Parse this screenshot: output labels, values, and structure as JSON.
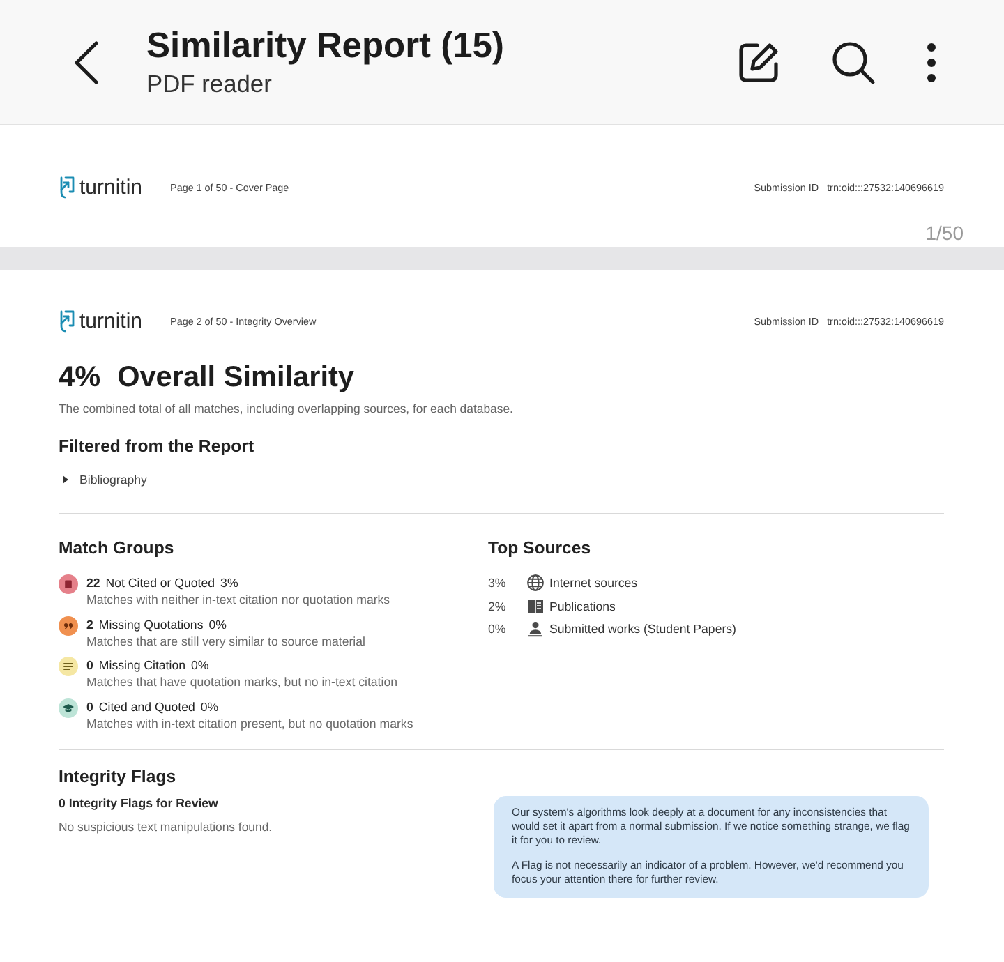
{
  "app_bar": {
    "title": "Similarity Report (15)",
    "subtitle": "PDF reader"
  },
  "cover_page": {
    "header": {
      "logo_text": "turnitin",
      "page_label": "Page 1 of 50 - Cover Page",
      "submission_label": "Submission ID",
      "submission_id": "trn:oid:::27532:140696619"
    },
    "page_counter": "1/50"
  },
  "overview_page": {
    "header": {
      "logo_text": "turnitin",
      "page_label": "Page 2 of 50 - Integrity Overview",
      "submission_label": "Submission ID",
      "submission_id": "trn:oid:::27532:140696619"
    },
    "overall": {
      "percent": "4%",
      "title": "Overall Similarity",
      "description": "The combined total of all matches, including overlapping sources, for each database."
    },
    "filtered": {
      "title": "Filtered from the Report",
      "items": [
        "Bibliography"
      ]
    },
    "match_groups": {
      "title": "Match Groups",
      "items": [
        {
          "kind": "not_cited",
          "color": "#e5808a",
          "count": "22",
          "label": "Not Cited or Quoted",
          "percent": "3%",
          "description": "Matches with neither in-text citation nor quotation marks"
        },
        {
          "kind": "missing_quotations",
          "color": "#f0904f",
          "count": "2",
          "label": "Missing Quotations",
          "percent": "0%",
          "description": "Matches that are still very similar to source material"
        },
        {
          "kind": "missing_citation",
          "color": "#f5e7a3",
          "count": "0",
          "label": "Missing Citation",
          "percent": "0%",
          "description": "Matches that have quotation marks, but no in-text citation"
        },
        {
          "kind": "cited_quoted",
          "color": "#bde4d7",
          "count": "0",
          "label": "Cited and Quoted",
          "percent": "0%",
          "description": "Matches with in-text citation present, but no quotation marks"
        }
      ]
    },
    "top_sources": {
      "title": "Top Sources",
      "items": [
        {
          "kind": "internet",
          "percent": "3%",
          "label": "Internet sources"
        },
        {
          "kind": "publications",
          "percent": "2%",
          "label": "Publications"
        },
        {
          "kind": "submitted",
          "percent": "0%",
          "label": "Submitted works (Student Papers)"
        }
      ]
    },
    "integrity_flags": {
      "title": "Integrity Flags",
      "subtitle": "0 Integrity Flags for Review",
      "message": "No suspicious text manipulations found.",
      "info": [
        "Our system's algorithms look deeply at a document for any inconsistencies that would set it apart from a normal submission. If we notice something strange, we flag it for you to review.",
        "A Flag is not necessarily an indicator of a problem. However, we'd recommend you focus your attention there for further review."
      ]
    }
  }
}
